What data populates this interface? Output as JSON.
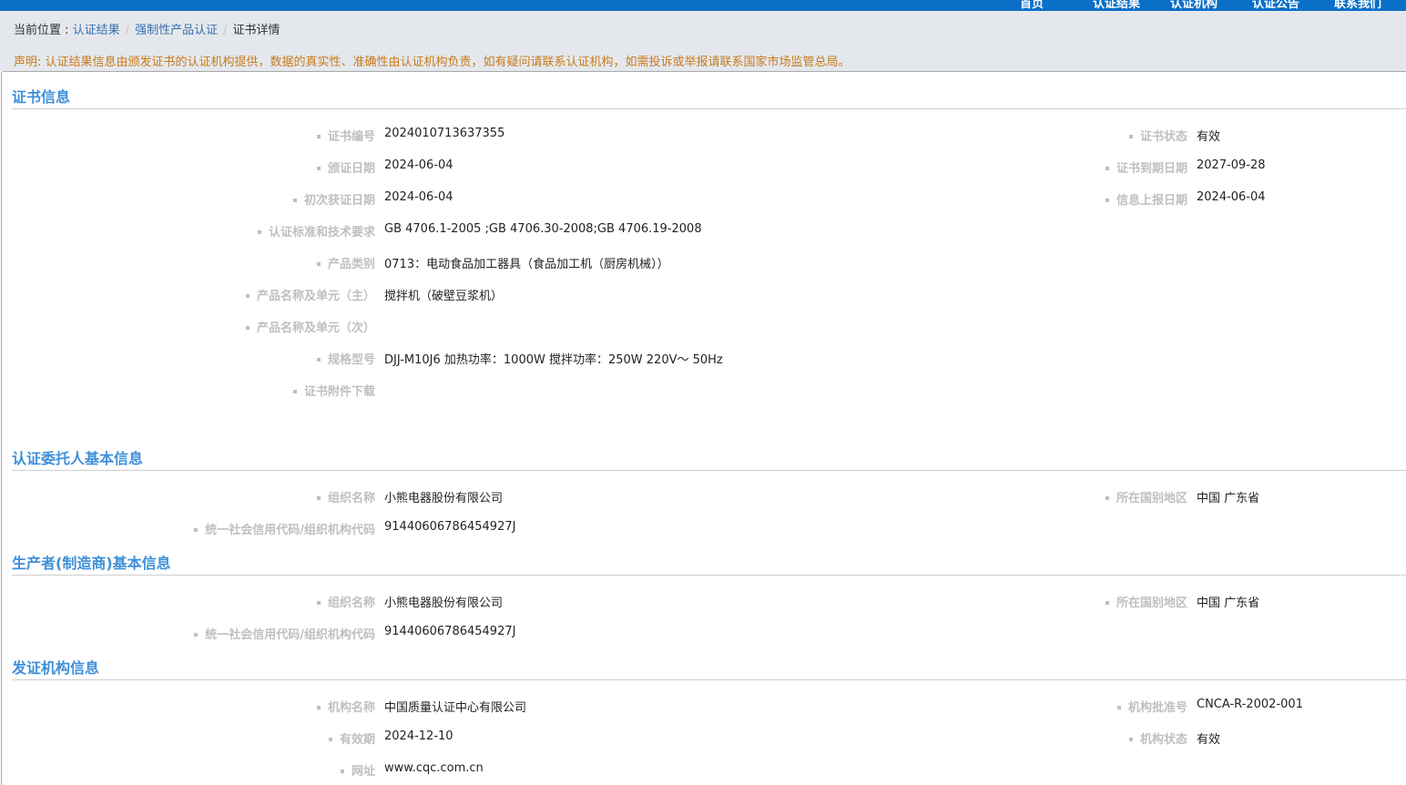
{
  "nav": {
    "item1": "首页",
    "item2": "认证结果",
    "item3": "认证机构",
    "item4": "认证公告",
    "item5": "联系我们"
  },
  "breadcrumb": {
    "prefix": "当前位置 : ",
    "item1": "认证结果",
    "item2": "强制性产品认证",
    "item3": "证书详情"
  },
  "notice": "声明: 认证结果信息由颁发证书的认证机构提供，数据的真实性、准确性由认证机构负责，如有疑问请联系认证机构，如需投诉或举报请联系国家市场监管总局。",
  "cert": {
    "title": "证书信息",
    "no_label": "证书编号",
    "no": "2024010713637355",
    "status_label": "证书状态",
    "status": "有效",
    "issue_label": "颁证日期",
    "issue": "2024-06-04",
    "expire_label": "证书到期日期",
    "expire": "2027-09-28",
    "first_label": "初次获证日期",
    "first": "2024-06-04",
    "report_label": "信息上报日期",
    "report": "2024-06-04",
    "std_label": "认证标准和技术要求",
    "std": "GB 4706.1-2005 ;GB 4706.30-2008;GB 4706.19-2008",
    "cat_label": "产品类别",
    "cat": "0713：电动食品加工器具（食品加工机（厨房机械））",
    "main_label": "产品名称及单元（主）",
    "main": "搅拌机（破壁豆浆机）",
    "sub_label": "产品名称及单元（次）",
    "sub": "",
    "model_label": "规格型号",
    "model": "DJJ-M10J6 加热功率：1000W 搅拌功率：250W 220V～ 50Hz",
    "attach_label": "证书附件下载"
  },
  "client": {
    "title": "认证委托人基本信息",
    "org_label": "组织名称",
    "org": "小熊电器股份有限公司",
    "region_label": "所在国别地区",
    "region": "中国 广东省",
    "code_label": "统一社会信用代码/组织机构代码",
    "code": "91440606786454927J"
  },
  "maker": {
    "title": "生产者(制造商)基本信息",
    "org_label": "组织名称",
    "org": "小熊电器股份有限公司",
    "region_label": "所在国别地区",
    "region": "中国 广东省",
    "code_label": "统一社会信用代码/组织机构代码",
    "code": "91440606786454927J"
  },
  "issuer": {
    "title": "发证机构信息",
    "name_label": "机构名称",
    "name": "中国质量认证中心有限公司",
    "approval_label": "机构批准号",
    "approval": "CNCA-R-2002-001",
    "valid_label": "有效期",
    "valid": "2024-12-10",
    "state_label": "机构状态",
    "state": "有效",
    "url_label": "网址",
    "url": "www.cqc.com.cn"
  }
}
